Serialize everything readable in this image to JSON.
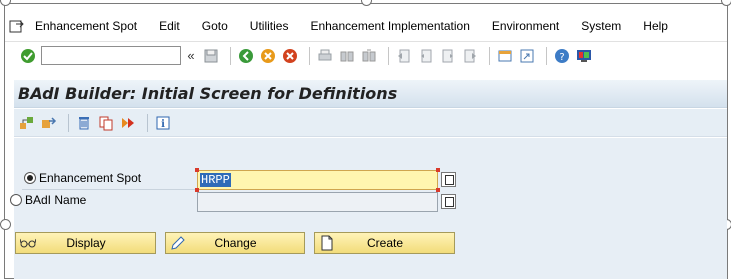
{
  "menubar": {
    "items": [
      "Enhancement Spot",
      "Edit",
      "Goto",
      "Utilities",
      "Enhancement Implementation",
      "Environment",
      "System",
      "Help"
    ]
  },
  "toolbar": {
    "command_field_value": ""
  },
  "title": "BAdI Builder: Initial Screen for Definitions",
  "form": {
    "enhancement_spot_label": "Enhancement Spot",
    "enhancement_spot_value": "HRPP",
    "enhancement_spot_selected": true,
    "badi_name_label": "BAdI Name",
    "badi_name_value": "",
    "badi_name_selected": false
  },
  "buttons": {
    "display": "Display",
    "change": "Change",
    "create": "Create"
  },
  "colors": {
    "title_bg": "#dbe6f0",
    "main_bg": "#e7eef5",
    "button_bg": "#f6e38f",
    "active_field_bg": "#fff6b0"
  }
}
